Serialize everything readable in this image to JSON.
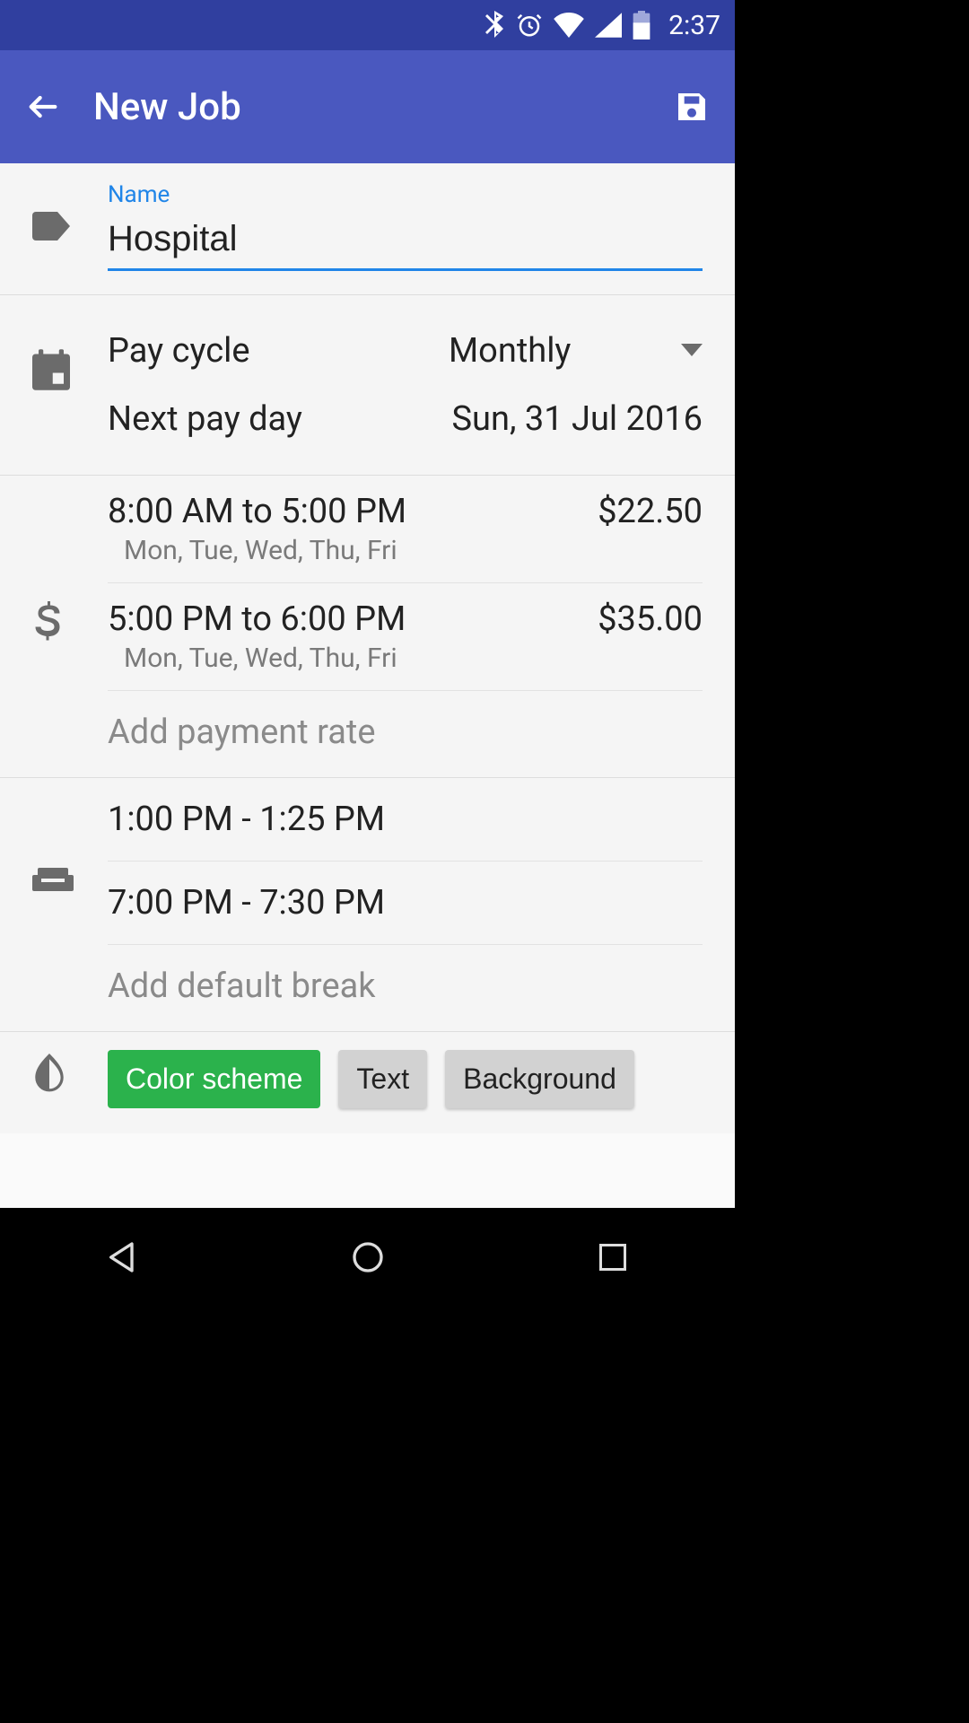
{
  "status": {
    "time": "2:37"
  },
  "appbar": {
    "title": "New Job"
  },
  "name": {
    "label": "Name",
    "value": "Hospital"
  },
  "pay": {
    "cycle_label": "Pay cycle",
    "cycle_value": "Monthly",
    "next_label": "Next pay day",
    "next_value": "Sun, 31 Jul 2016"
  },
  "rates": [
    {
      "time": "8:00 AM to 5:00 PM",
      "days": "Mon, Tue, Wed, Thu, Fri",
      "amount": "$22.50"
    },
    {
      "time": "5:00 PM to 6:00 PM",
      "days": "Mon, Tue, Wed, Thu, Fri",
      "amount": "$35.00"
    }
  ],
  "rates_add": "Add payment rate",
  "breaks": [
    {
      "time": "1:00 PM - 1:25 PM"
    },
    {
      "time": "7:00 PM - 7:30 PM"
    }
  ],
  "breaks_add": "Add default break",
  "color": {
    "scheme": "Color scheme",
    "text": "Text",
    "background": "Background"
  }
}
